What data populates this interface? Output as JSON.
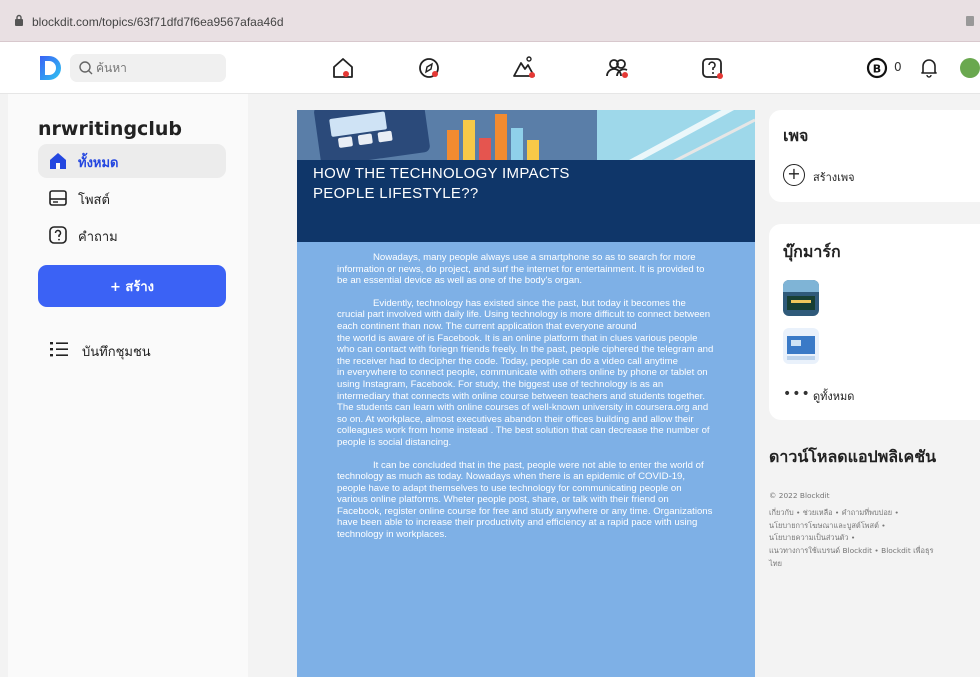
{
  "browser": {
    "url": "blockdit.com/topics/63f71dfd7f6ea9567afaa46d"
  },
  "topnav": {
    "search_placeholder": "ค้นหา",
    "icons": [
      "home-icon",
      "explore-icon",
      "trending-icon",
      "community-icon",
      "question-icon"
    ],
    "coin_count": "0",
    "accent": "#e53935"
  },
  "sidebar": {
    "club_name": "nrwritingclub",
    "items": [
      {
        "label": "ทั้งหมด",
        "icon": "home-icon",
        "active": true
      },
      {
        "label": "โพสต์",
        "icon": "post-icon",
        "active": false
      },
      {
        "label": "คำถาม",
        "icon": "question-icon",
        "active": false
      }
    ],
    "create_label": "+ สร้าง",
    "notes_label": "บันทึกชุมชน"
  },
  "post": {
    "title": "HOW THE TECHNOLOGY IMPACTS PEOPLE LIFESTYLE??",
    "paragraphs": [
      "Nowadays, many people always use a smartphone so as to search for more information or news, do project, and surf the internet for entertainment. It is provided to be an essential device as well as one of the body's organ.",
      "Evidently, technology has existed since the past, but today it becomes the crucial part involved with daily life. Using technology is more difficult to connect between each continent than now. The current application that everyone around\nthe world is aware of is Facebook. It is an online platform that in clues various people who can contact with foriegn friends freely. In the past, people ciphered the telegram and the receiver had to decipher the code. Today, people can do a video call anytime\nin everywhere to connect people, communicate with others online by phone or tablet on using Instagram, Facebook. For study, the biggest use of technology is as an intermediary that connects with online course between teachers and students together. The students can learn with online courses of well-known university in coursera.org and so on. At workplace, almost executives abandon their offices building and allow their colleagues work from home instead . The best solution that can decrease the number of people is social distancing.",
      "It can be concluded that in the past, people were not able to enter the world of technology as much as today. Nowadays when there is an epidemic of COVID-19, people have to adapt themselves to use technology for communicating people on various online platforms. Wheter people post, share, or talk with their friend on Facebook, register online course for free and study anywhere or any time. Organizations have been able to increase their productivity and efficiency at a rapid pace with using technology in workplaces."
    ],
    "colors": {
      "background": "#7eb0e6",
      "title_band": "#0f3669"
    }
  },
  "right": {
    "pages_title": "เพจ",
    "create_page_label": "สร้างเพจ",
    "bookmarks_title": "บุ๊กมาร์ก",
    "see_all_label": "ดูทั้งหมด",
    "download_title": "ดาวน์โหลดแอปพลิเคชัน",
    "footer": {
      "copyright": "© 2022 Blockdit",
      "line1": "เกี่ยวกับ • ช่วยเหลือ • คำถามที่พบบ่อย •",
      "line2": "นโยบายการโฆษณาและบูสต์โพสต์ •",
      "line3": "นโยบายความเป็นส่วนตัว •",
      "line4": "แนวทางการใช้แบรนด์ Blockdit • Blockdit เพื่อธุร",
      "line5": "ไทย"
    }
  }
}
